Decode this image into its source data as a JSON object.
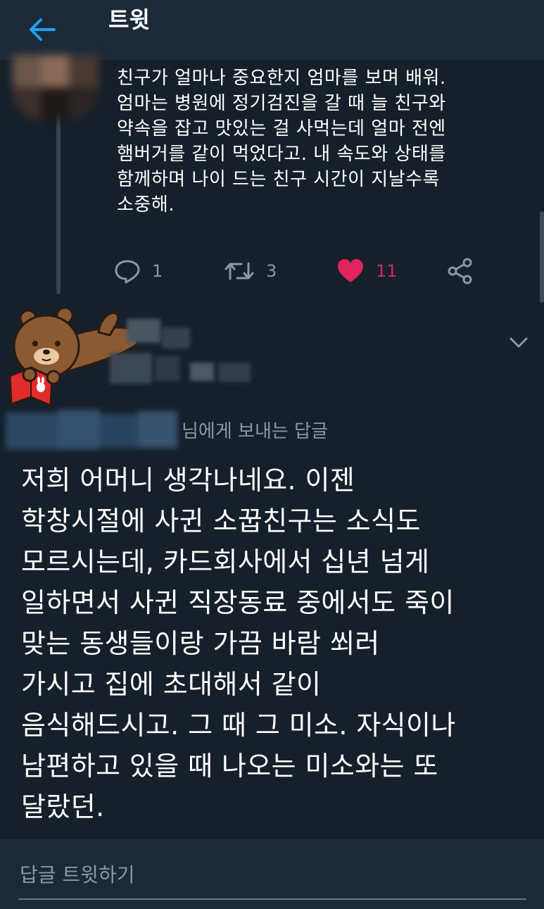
{
  "header": {
    "title": "트윗",
    "back_icon": "arrow-left-icon"
  },
  "tweet": {
    "lines": [
      "친구가 얼마나 중요한지 엄마를 보며 배워.",
      "엄마는 병원에 정기검진을 갈 때 늘 친구와",
      "약속을 잡고 맛있는 걸 사먹는데 얼마 전엔",
      "햄버거를 같이 먹었다고. 내 속도와 상태를",
      "함께하며 나이 드는 친구 시간이 지날수록",
      "소중해."
    ],
    "actions": {
      "reply_count": "1",
      "retweet_count": "3",
      "like_count": "11"
    },
    "colors": {
      "like": "#e0245e",
      "icon": "#8899a6"
    }
  },
  "reply": {
    "reply_to_suffix": "님에게 보내는 답글",
    "lines": [
      "저희 어머니 생각나네요. 이젠",
      "학창시절에 사귄 소꿉친구는 소식도",
      "모르시는데, 카드회사에서 십년 넘게",
      "일하면서 사귄 직장동료 중에서도 죽이",
      "맞는 동생들이랑 가끔 바람 쐬러",
      "가시고 집에 초대해서 같이",
      "음식해드시고. 그 때 그 미소. 자식이나",
      "남편하고 있을 때 나오는 미소와는 또",
      "달랐던."
    ]
  },
  "compose": {
    "placeholder": "답글 트윗하기"
  }
}
